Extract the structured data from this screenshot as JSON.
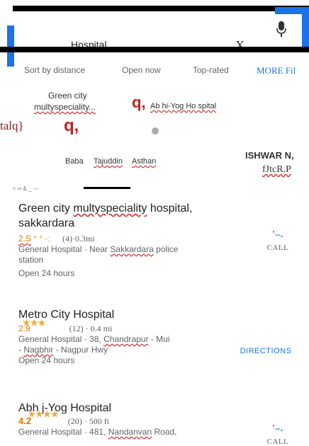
{
  "search": {
    "query": "Hospital",
    "close_label": "X"
  },
  "filters": [
    "Sort by distance",
    "Open now",
    "Top-rated",
    "MORE Fil"
  ],
  "map": {
    "labels": {
      "green_city": [
        "Green city",
        "multyspeciality..."
      ],
      "abhi_yog": "Ab hi-Yog Ho spital",
      "talq": "talq}",
      "pin_glyph": "q,",
      "baba": [
        "Baba",
        "Tajuddin",
        "Asthan"
      ],
      "ishwar": "ISHWAR N,",
      "fjtcr": "fJtcR.P",
      "marks": "≈ ∞ & _ ---"
    }
  },
  "results": [
    {
      "title_parts": [
        "Green city ",
        "multyspeciality",
        " hospital,"
      ],
      "title_line2": "sakkardara",
      "rating": "2.S",
      "stars": "* * -;",
      "reviews": "(4)·0.3mi",
      "meta_prefix": "General  Hospital  · Near ",
      "meta_link": "Sakkardara",
      "meta_suffix": "  police",
      "meta_line2": "station",
      "hours": "Open  24  hours",
      "action": "CALL"
    },
    {
      "title_parts": [
        "Metro City Hospital"
      ],
      "rating": "2.9",
      "stars": "★★★",
      "reviews": "(12)  ·  0.4  mi",
      "meta_prefix": "General  Hospital  · 38, ",
      "meta_link": "Chandrapur",
      "meta_suffix": "  - Mui",
      "meta_line2_link": "Nagbhir",
      "meta_line2_suffix": " - Nagpur  Hwy",
      "hours": "Open  24  hours",
      "action": "DIRECTIONS"
    },
    {
      "title_parts": [
        "Abh j-Yog  Hospital"
      ],
      "rating": "4.2",
      "stars": "★★★★",
      "reviews": "(20)  ·  500  ft",
      "meta_prefix": "General  Hospital  · 481, ",
      "meta_link": "Nandanvan",
      "meta_suffix": "  Road,",
      "action": "CALL"
    }
  ],
  "colors": {
    "accent": "#1a73e8",
    "pin": "#c5221f",
    "rating": "#e37400"
  },
  "icons": [
    "mic-icon",
    "close-icon",
    "call-icon",
    "map-pin-icon"
  ]
}
